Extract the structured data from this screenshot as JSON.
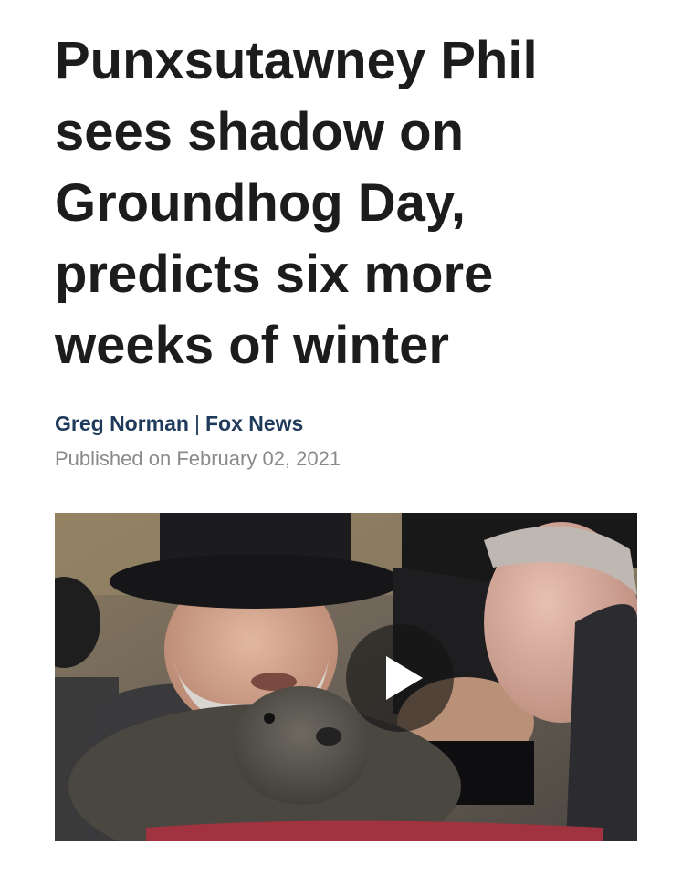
{
  "article": {
    "headline_lines": [
      "Punxsutawney Phil",
      "sees shadow on",
      "Groundhog Day,",
      "predicts six more",
      "weeks of winter"
    ],
    "author": "Greg Norman",
    "separator": "|",
    "outlet": "Fox News",
    "published": "Published on February 02, 2021"
  },
  "video": {
    "play_icon": "play-icon"
  },
  "colors": {
    "headline": "#1c1c1c",
    "byline": "#1f3a5a",
    "published": "#8a8a8a",
    "background": "#ffffff"
  }
}
